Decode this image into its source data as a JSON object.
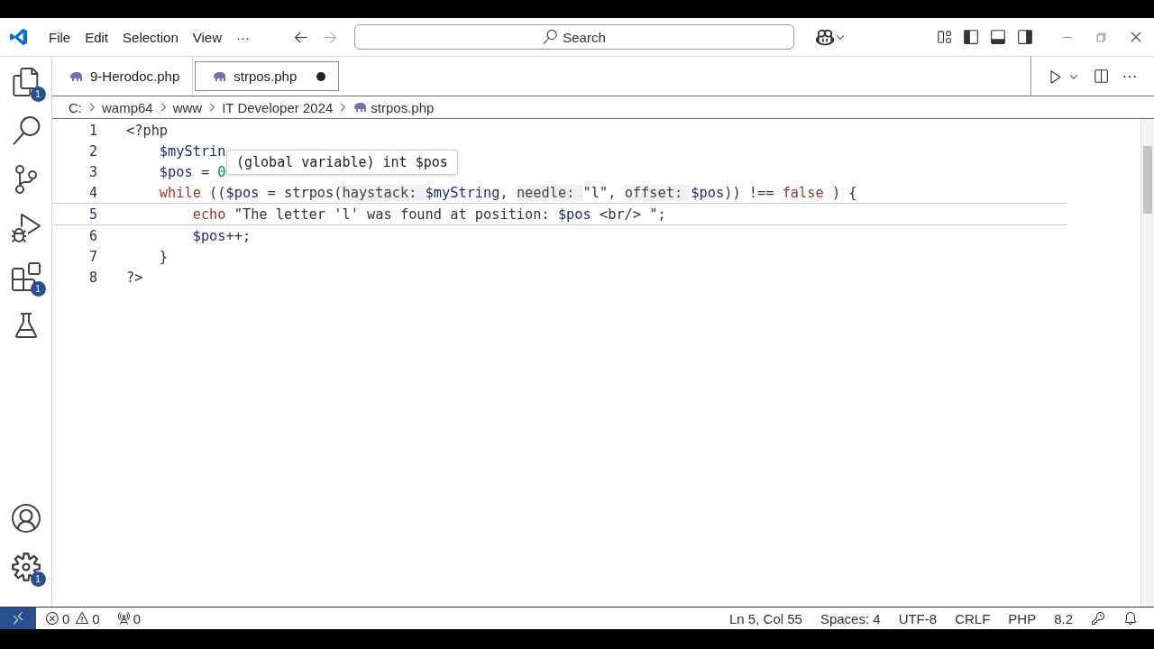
{
  "menu": [
    "File",
    "Edit",
    "Selection",
    "View",
    "···"
  ],
  "search": {
    "placeholder": "Search"
  },
  "activity_bar": [
    {
      "kind": "files",
      "badge": "1"
    },
    {
      "kind": "search"
    },
    {
      "kind": "source-control"
    },
    {
      "kind": "debug"
    },
    {
      "kind": "extensions",
      "badge": "1"
    },
    {
      "kind": "testing"
    }
  ],
  "activity_bar_bottom": [
    {
      "kind": "account"
    },
    {
      "kind": "settings",
      "badge": "1"
    }
  ],
  "tabs": [
    {
      "label": "9-Herodoc.php",
      "selected": false,
      "modified": false
    },
    {
      "label": "strpos.php",
      "selected": true,
      "modified": true
    }
  ],
  "breadcrumb": [
    "C:",
    "wamp64",
    "www",
    "IT Developer 2024",
    "strpos.php"
  ],
  "code": [
    {
      "number": "1",
      "current": false,
      "tokens": [
        {
          "kind": "tag",
          "text": "<?php"
        }
      ]
    },
    {
      "number": "2",
      "current": false,
      "tokens": [
        {
          "kind": "var",
          "text": "    $myStrin"
        }
      ]
    },
    {
      "number": "3",
      "current": false,
      "tokens": [
        {
          "kind": "var",
          "text": "    $pos"
        },
        {
          "kind": "plain",
          "text": " = "
        },
        {
          "kind": "number",
          "text": "0"
        }
      ]
    },
    {
      "number": "4",
      "current": false,
      "tokens": [
        {
          "kind": "keyword",
          "text": "    while"
        },
        {
          "kind": "plain",
          "text": " (("
        },
        {
          "kind": "var",
          "text": "$pos"
        },
        {
          "kind": "plain",
          "text": " = "
        },
        {
          "kind": "func",
          "text": "strpos("
        },
        {
          "kind": "hint",
          "text": "haystack: "
        },
        {
          "kind": "var",
          "text": "$myString"
        },
        {
          "kind": "plain",
          "text": ", "
        },
        {
          "kind": "hint",
          "text": "needle: "
        },
        {
          "kind": "string",
          "text": "\"l\""
        },
        {
          "kind": "plain",
          "text": ", "
        },
        {
          "kind": "hint",
          "text": "offset: "
        },
        {
          "kind": "var",
          "text": "$pos"
        },
        {
          "kind": "plain",
          "text": ")) !== "
        },
        {
          "kind": "keyword",
          "text": "false"
        },
        {
          "kind": "plain",
          "text": " ) {"
        }
      ]
    },
    {
      "number": "5",
      "current": true,
      "tokens": [
        {
          "kind": "keyword",
          "text": "        echo "
        },
        {
          "kind": "string",
          "text": "\"The letter 'l' was found at position: "
        },
        {
          "kind": "var",
          "text": "$pos"
        },
        {
          "kind": "string",
          "text": " <br/> \""
        },
        {
          "kind": "plain",
          "text": ";"
        }
      ]
    },
    {
      "number": "6",
      "current": false,
      "tokens": [
        {
          "kind": "var",
          "text": "        $pos"
        },
        {
          "kind": "plain",
          "text": "++;"
        }
      ]
    },
    {
      "number": "7",
      "current": false,
      "tokens": [
        {
          "kind": "plain",
          "text": "    }"
        }
      ]
    },
    {
      "number": "8",
      "current": false,
      "tokens": [
        {
          "kind": "tag",
          "text": "?>"
        }
      ]
    }
  ],
  "hover": {
    "text": "(global variable) int $pos"
  },
  "status_bar": {
    "problems": [
      {
        "kind": "error",
        "count": "0"
      },
      {
        "kind": "warning",
        "count": "0"
      },
      {
        "kind": "ports",
        "count": "0"
      }
    ],
    "items": [
      "Ln 5, Col 55",
      "Spaces: 4",
      "UTF-8",
      "CRLF",
      "PHP",
      "8.2"
    ]
  }
}
